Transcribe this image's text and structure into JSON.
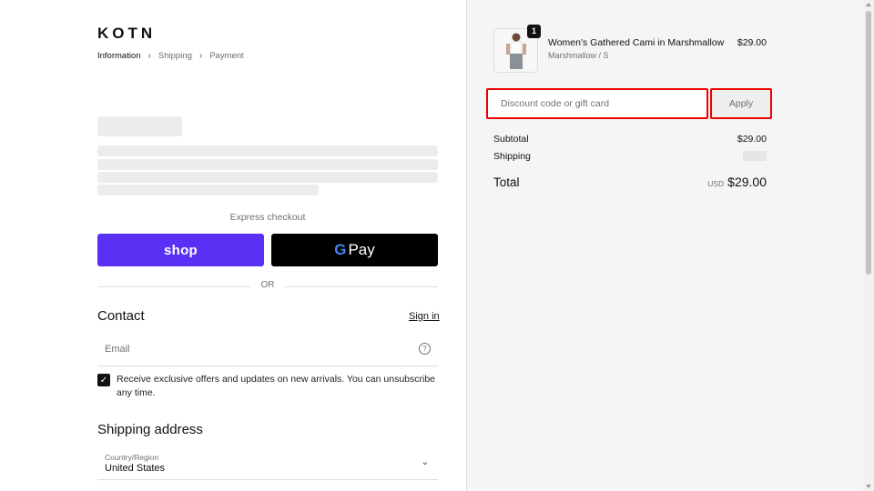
{
  "brand": {
    "logo": "KOTN"
  },
  "breadcrumb": {
    "items": [
      {
        "label": "Information"
      },
      {
        "label": "Shipping"
      },
      {
        "label": "Payment"
      }
    ],
    "separator": ">"
  },
  "express": {
    "label": "Express checkout",
    "shop_label": "shop",
    "gpay_g": "G",
    "gpay_label": "Pay",
    "shop_color": "#5a31f4"
  },
  "divider": {
    "or_label": "OR"
  },
  "contact": {
    "heading": "Contact",
    "sign_in": "Sign in",
    "email_placeholder": "Email",
    "help_icon": "?",
    "offers_text": "Receive exclusive offers and updates on new arrivals. You can unsubscribe any time.",
    "offers_checked": true
  },
  "shipping": {
    "heading": "Shipping address",
    "country_label": "Country/Region",
    "country_value": "United States"
  },
  "order": {
    "item": {
      "name": "Women's Gathered Cami in Marshmallow",
      "variant": "Marshmallow / S",
      "price": "$29.00",
      "quantity": "1"
    },
    "discount_placeholder": "Discount code or gift card",
    "apply_label": "Apply",
    "subtotal_label": "Subtotal",
    "subtotal_value": "$29.00",
    "shipping_label": "Shipping",
    "total_label": "Total",
    "total_currency": "USD",
    "total_value": "$29.00"
  },
  "colors": {
    "highlight": "#e00000"
  }
}
